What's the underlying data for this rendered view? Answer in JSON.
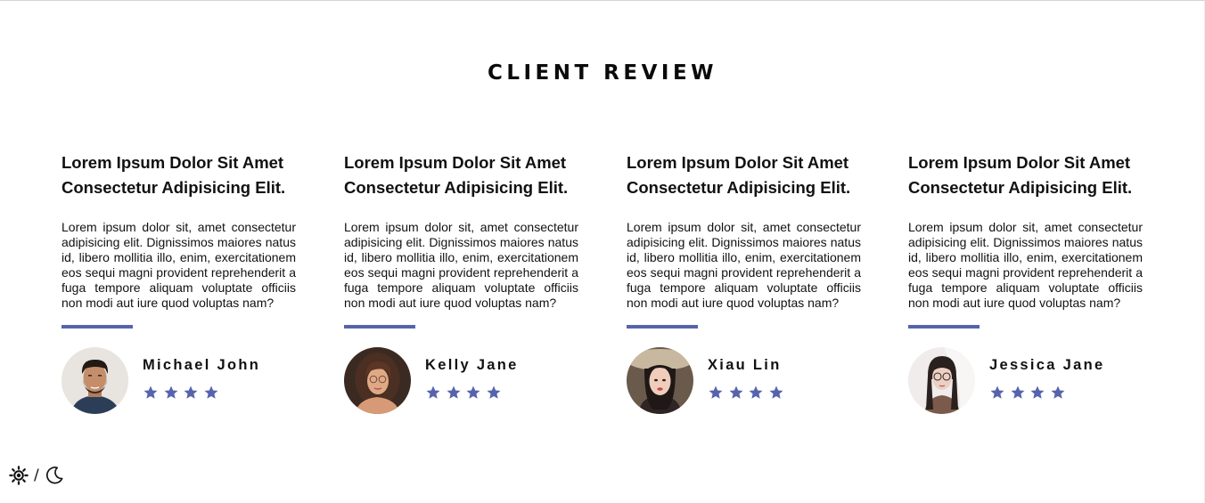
{
  "section": {
    "title": "CLIENT REVIEW"
  },
  "colors": {
    "accent": "#5664ad",
    "text": "#111111",
    "background": "#ffffff"
  },
  "reviews": [
    {
      "heading_line1": "Lorem Ipsum Dolor Sit Amet",
      "heading_line2": "Consectetur Adipisicing Elit.",
      "text": "Lorem ipsum dolor sit, amet consectetur adipisicing elit. Dignissimos maiores natus id, libero mollitia illo, enim, exercitationem eos sequi magni provident reprehenderit a fuga tempore aliquam voluptate officiis non modi aut iure quod voluptas nam?",
      "author": "Michael John",
      "rating": 4,
      "avatar_icon": "man-portrait-photo"
    },
    {
      "heading_line1": "Lorem Ipsum Dolor Sit Amet",
      "heading_line2": "Consectetur Adipisicing Elit.",
      "text": "Lorem ipsum dolor sit, amet consectetur adipisicing elit. Dignissimos maiores natus id, libero mollitia illo, enim, exercitationem eos sequi magni provident reprehenderit a fuga tempore aliquam voluptate officiis non modi aut iure quod voluptas nam?",
      "author": "Kelly Jane",
      "rating": 4,
      "avatar_icon": "woman-portrait-photo"
    },
    {
      "heading_line1": "Lorem Ipsum Dolor Sit Amet",
      "heading_line2": "Consectetur Adipisicing Elit.",
      "text": "Lorem ipsum dolor sit, amet consectetur adipisicing elit. Dignissimos maiores natus id, libero mollitia illo, enim, exercitationem eos sequi magni provident reprehenderit a fuga tempore aliquam voluptate officiis non modi aut iure quod voluptas nam?",
      "author": "Xiau Lin",
      "rating": 4,
      "avatar_icon": "woman-with-hat-portrait-photo"
    },
    {
      "heading_line1": "Lorem Ipsum Dolor Sit Amet",
      "heading_line2": "Consectetur Adipisicing Elit.",
      "text": "Lorem ipsum dolor sit, amet consectetur adipisicing elit. Dignissimos maiores natus id, libero mollitia illo, enim, exercitationem eos sequi magni provident reprehenderit a fuga tempore aliquam voluptate officiis non modi aut iure quod voluptas nam?",
      "author": "Jessica Jane",
      "rating": 4,
      "avatar_icon": "woman-with-glasses-portrait-photo"
    }
  ],
  "theme_toggle": {
    "light_icon": "sun-icon",
    "separator": "/",
    "dark_icon": "moon-icon"
  }
}
